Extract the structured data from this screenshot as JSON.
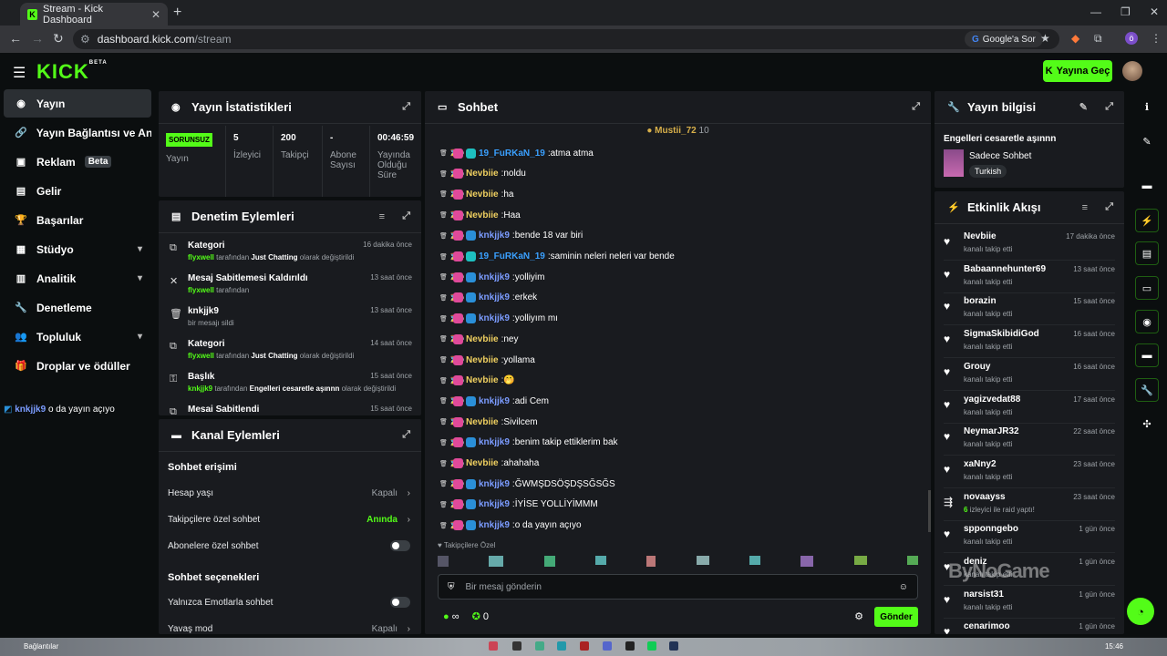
{
  "browser": {
    "tab_title": "Stream - Kick Dashboard",
    "url_host": "dashboard.kick.com",
    "url_path": "/stream",
    "google_btn": "Google'a Sor"
  },
  "header": {
    "logo": "KICK",
    "logo_beta": "BETA",
    "golive": "Yayına Geç"
  },
  "sidebar": {
    "items": [
      {
        "label": "Yayın"
      },
      {
        "label": "Yayın Bağlantısı ve Anahtarı"
      },
      {
        "label": "Reklam",
        "badge": "Beta"
      },
      {
        "label": "Gelir"
      },
      {
        "label": "Başarılar"
      },
      {
        "label": "Stüdyo"
      },
      {
        "label": "Analitik"
      },
      {
        "label": "Denetleme"
      },
      {
        "label": "Topluluk"
      },
      {
        "label": "Droplar ve ödüller"
      }
    ],
    "chat_user": "knkjjk9",
    "chat_text": "o da yayın açıyo"
  },
  "stats": {
    "title": "Yayın İstatistikleri",
    "status": "SORUNSUZ",
    "status_label": "Yayın",
    "viewers": "5",
    "viewers_label": "İzleyici",
    "followers": "200",
    "followers_label": "Takipçi",
    "subs": "-",
    "subs_label": "Abone Sayısı",
    "uptime": "00:46:59",
    "uptime_label": "Yayında Olduğu Süre"
  },
  "moderation": {
    "title": "Denetim Eylemleri",
    "rows": [
      {
        "title": "Kategori",
        "pre": "flyxwell",
        "mid": " tarafından ",
        "hl": "Just Chatting",
        "post": " olarak değiştirildi",
        "time": "16 dakika önce",
        "icon": "⧉"
      },
      {
        "title": "Mesaj Sabitlemesi Kaldırıldı",
        "pre": "flyxwell",
        "mid": " tarafından",
        "hl": "",
        "post": "",
        "time": "13 saat önce",
        "icon": "✕"
      },
      {
        "title": "knkjjk9",
        "pre": "",
        "mid": "bir mesajı sildi",
        "hl": "",
        "post": "",
        "time": "13 saat önce",
        "icon": "🗑"
      },
      {
        "title": "Kategori",
        "pre": "flyxwell",
        "mid": " tarafından ",
        "hl": "Just Chatting",
        "post": " olarak değiştirildi",
        "time": "14 saat önce",
        "icon": "⧉"
      },
      {
        "title": "Başlık",
        "pre": "knkjjk9",
        "mid": " tarafından ",
        "hl": "Engelleri cesaretle aşınnn",
        "post": " olarak değiştirildi",
        "time": "15 saat önce",
        "icon": "⚿"
      },
      {
        "title": "Mesai Sabitlendi",
        "pre": "",
        "mid": "",
        "hl": "",
        "post": "",
        "time": "15 saat önce",
        "icon": "⧉"
      }
    ]
  },
  "channel": {
    "title": "Kanal Eylemleri",
    "sec1": "Sohbet erişimi",
    "opt1": "Hesap yaşı",
    "opt1_val": "Kapalı",
    "opt2": "Takipçilere özel sohbet",
    "opt2_val": "Anında",
    "opt3": "Abonelere özel sohbet",
    "sec2": "Sohbet seçenekleri",
    "opt4": "Yalnızca Emotlarla sohbet",
    "opt5": "Yavaş mod",
    "opt5_val": "Kapalı"
  },
  "chat": {
    "title": "Sohbet",
    "pinned_user": "Mustii_72",
    "pinned_count": "10",
    "messages": [
      {
        "user": "19_FuRKaN_19",
        "text": "atma atma",
        "color": "#3aa0ff",
        "badge": "#1ec0c0"
      },
      {
        "user": "Nevbiie",
        "text": "noldu",
        "color": "#f0d060",
        "badge": ""
      },
      {
        "user": "Nevbiie",
        "text": "ha",
        "color": "#f0d060",
        "badge": ""
      },
      {
        "user": "Nevbiie",
        "text": "Haa",
        "color": "#f0d060",
        "badge": ""
      },
      {
        "user": "knkjjk9",
        "text": "bende 18 var biri",
        "color": "#7b9cff",
        "badge": "#2a8fd8"
      },
      {
        "user": "19_FuRKaN_19",
        "text": "saminin neleri neleri var bende",
        "color": "#3aa0ff",
        "badge": "#1ec0c0"
      },
      {
        "user": "knkjjk9",
        "text": "yolliyim",
        "color": "#7b9cff",
        "badge": "#2a8fd8"
      },
      {
        "user": "knkjjk9",
        "text": "erkek",
        "color": "#7b9cff",
        "badge": "#2a8fd8"
      },
      {
        "user": "knkjjk9",
        "text": "yolliyım mı",
        "color": "#7b9cff",
        "badge": "#2a8fd8"
      },
      {
        "user": "Nevbiie",
        "text": "ney",
        "color": "#f0d060",
        "badge": ""
      },
      {
        "user": "Nevbiie",
        "text": "yollama",
        "color": "#f0d060",
        "badge": ""
      },
      {
        "user": "Nevbiie",
        "text": "🤭",
        "color": "#f0d060",
        "badge": ""
      },
      {
        "user": "knkjjk9",
        "text": "adi Cem",
        "color": "#7b9cff",
        "badge": "#2a8fd8"
      },
      {
        "user": "Nevbiie",
        "text": "Sivilcem",
        "color": "#f0d060",
        "badge": ""
      },
      {
        "user": "knkjjk9",
        "text": "benim takip ettiklerim bak",
        "color": "#7b9cff",
        "badge": "#2a8fd8"
      },
      {
        "user": "Nevbiie",
        "text": "ahahaha",
        "color": "#f0d060",
        "badge": ""
      },
      {
        "user": "knkjjk9",
        "text": "ĞWMŞDSÖŞDŞSĞSĞS",
        "color": "#7b9cff",
        "badge": "#2a8fd8"
      },
      {
        "user": "knkjjk9",
        "text": "İYİSE YOLLİYİMMM",
        "color": "#7b9cff",
        "badge": "#2a8fd8"
      },
      {
        "user": "knkjjk9",
        "text": "o da yayın açıyo",
        "color": "#7b9cff",
        "badge": "#2a8fd8"
      }
    ],
    "followers_only": "Takipçilere Özel",
    "input_placeholder": "Bir mesaj gönderin",
    "count": "0",
    "send": "Gönder"
  },
  "info": {
    "title": "Yayın bilgisi",
    "stream_title": "Engelleri cesaretle aşınnn",
    "category": "Sadece Sohbet",
    "tag": "Turkish"
  },
  "activity": {
    "title": "Etkinlik Akışı",
    "items": [
      {
        "name": "Nevbiie",
        "text": "kanalı takip etti",
        "time": "17 dakika önce",
        "raid": ""
      },
      {
        "name": "Babaannehunter69",
        "text": "kanalı takip etti",
        "time": "13 saat önce",
        "raid": ""
      },
      {
        "name": "borazin",
        "text": "kanalı takip etti",
        "time": "15 saat önce",
        "raid": ""
      },
      {
        "name": "SigmaSkibidiGod",
        "text": "kanalı takip etti",
        "time": "16 saat önce",
        "raid": ""
      },
      {
        "name": "Grouy",
        "text": "kanalı takip etti",
        "time": "16 saat önce",
        "raid": ""
      },
      {
        "name": "yagizvedat88",
        "text": "kanalı takip etti",
        "time": "17 saat önce",
        "raid": ""
      },
      {
        "name": "NeymarJR32",
        "text": "kanalı takip etti",
        "time": "22 saat önce",
        "raid": ""
      },
      {
        "name": "xaNny2",
        "text": "kanalı takip etti",
        "time": "23 saat önce",
        "raid": ""
      },
      {
        "name": "novaayss",
        "text": " izleyici ile raid yaptı!",
        "time": "23 saat önce",
        "raid": "6"
      },
      {
        "name": "spponngebo",
        "text": "kanalı takip etti",
        "time": "1 gün önce",
        "raid": ""
      },
      {
        "name": "deniz",
        "text": "kanalı takip etti",
        "time": "1 gün önce",
        "raid": ""
      },
      {
        "name": "narsist31",
        "text": "kanalı takip etti",
        "time": "1 gün önce",
        "raid": ""
      },
      {
        "name": "cenarimoo",
        "text": "kanalı takip etti",
        "time": "1 gün önce",
        "raid": ""
      }
    ]
  },
  "taskbar": {
    "left": "Bağlantılar",
    "clock": "15:46"
  },
  "watermark": "ByNoGame"
}
